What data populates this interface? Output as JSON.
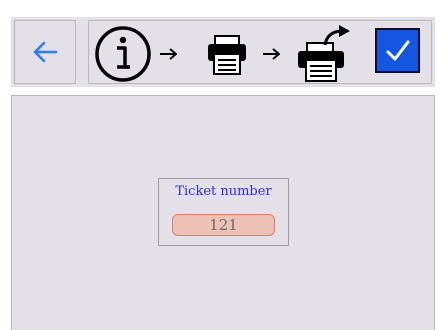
{
  "toolbar": {
    "back_icon": "arrow-left-icon",
    "steps": [
      {
        "icon": "info-icon",
        "state": "current"
      },
      {
        "icon": "printer-icon",
        "state": "pending"
      },
      {
        "icon": "print-share-icon",
        "state": "pending"
      }
    ],
    "confirm_icon": "checkmark-icon"
  },
  "ticket": {
    "label": "Ticket number",
    "value": "121"
  },
  "colors": {
    "panel_bg": "#e3e0e8",
    "accent_blue": "#1556e0",
    "back_arrow": "#2f7cf6",
    "label_blue": "#2a2fe0",
    "field_bg": "#ecc2b5",
    "field_border": "#e07c62"
  }
}
